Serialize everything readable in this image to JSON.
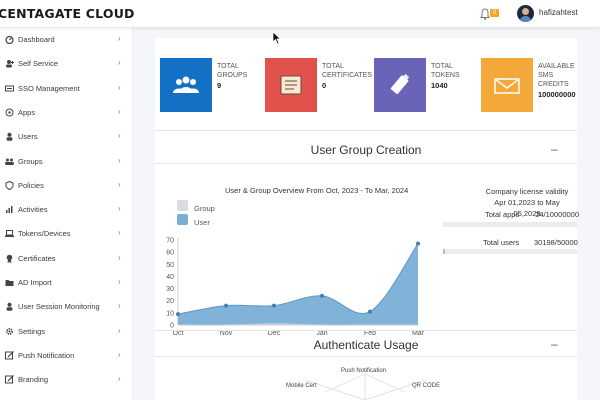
{
  "app": {
    "brand": "CENTAGATE CLOUD",
    "notification_count": "0",
    "username": "hafizahtest"
  },
  "sidebar": {
    "items": [
      {
        "label": "Dashboard",
        "icon": "dashboard-icon"
      },
      {
        "label": "Self Service",
        "icon": "user-plus-icon"
      },
      {
        "label": "SSO Management",
        "icon": "sso-icon"
      },
      {
        "label": "Apps",
        "icon": "apps-icon"
      },
      {
        "label": "Users",
        "icon": "user-icon"
      },
      {
        "label": "Groups",
        "icon": "group-icon"
      },
      {
        "label": "Policies",
        "icon": "shield-icon"
      },
      {
        "label": "Activities",
        "icon": "activity-chart-icon"
      },
      {
        "label": "Tokens/Devices",
        "icon": "laptop-icon"
      },
      {
        "label": "Certificates",
        "icon": "certificate-icon"
      },
      {
        "label": "AD Import",
        "icon": "folder-icon"
      },
      {
        "label": "User Session Monitoring",
        "icon": "session-user-icon"
      },
      {
        "label": "Settings",
        "icon": "gear-icon"
      },
      {
        "label": "Push Notification",
        "icon": "push-edit-icon"
      },
      {
        "label": "Branding",
        "icon": "branding-edit-icon"
      }
    ]
  },
  "cards": [
    {
      "line1": "TOTAL",
      "line2": "GROUPS",
      "line3": "",
      "value": "9",
      "color": "#1470c4",
      "icon": "group-icon"
    },
    {
      "line1": "TOTAL",
      "line2": "CERTIFICATES",
      "line3": "",
      "value": "0",
      "color": "#e0524b",
      "icon": "certificate-icon"
    },
    {
      "line1": "TOTAL",
      "line2": "TOKENS",
      "line3": "",
      "value": "1040",
      "color": "#6a64b8",
      "icon": "token-usb-icon"
    },
    {
      "line1": "AVAILABLE",
      "line2": "SMS",
      "line3": "CREDITS",
      "value": "100000000",
      "color": "#f4a83a",
      "icon": "envelope-icon"
    }
  ],
  "sections": {
    "user_group": "User Group Creation",
    "authenticate": "Authenticate Usage",
    "minus": "–"
  },
  "chart_data": {
    "type": "area",
    "title": "User & Group Overview From Oct, 2023 - To Mar, 2024",
    "categories": [
      "Oct",
      "Nov",
      "Dec",
      "Jan",
      "Feb",
      "Mar"
    ],
    "series": [
      {
        "name": "Group",
        "values": [
          0,
          0,
          1,
          0,
          0,
          0
        ],
        "color": "#d9dde2"
      },
      {
        "name": "User",
        "values": [
          9,
          16,
          16,
          24,
          11,
          67
        ],
        "color": "#7aaed6"
      }
    ],
    "ylim": [
      0,
      70
    ],
    "yticks": [
      0,
      10,
      20,
      30,
      40,
      50,
      60,
      70
    ],
    "grid": false,
    "legend": "top-left"
  },
  "license": {
    "title_line1": "Company license validity",
    "title_line2": "Apr 01,2023 to May 05,2029",
    "rows": [
      {
        "label": "Total apps",
        "value": "24/10000000",
        "fraction": 2.4e-06
      },
      {
        "label": "Total users",
        "value": "30198/50000000",
        "fraction": 0.0006
      }
    ]
  },
  "radar": {
    "labels": [
      "Push Notification",
      "Mobile Cert",
      "QR CODE"
    ]
  }
}
